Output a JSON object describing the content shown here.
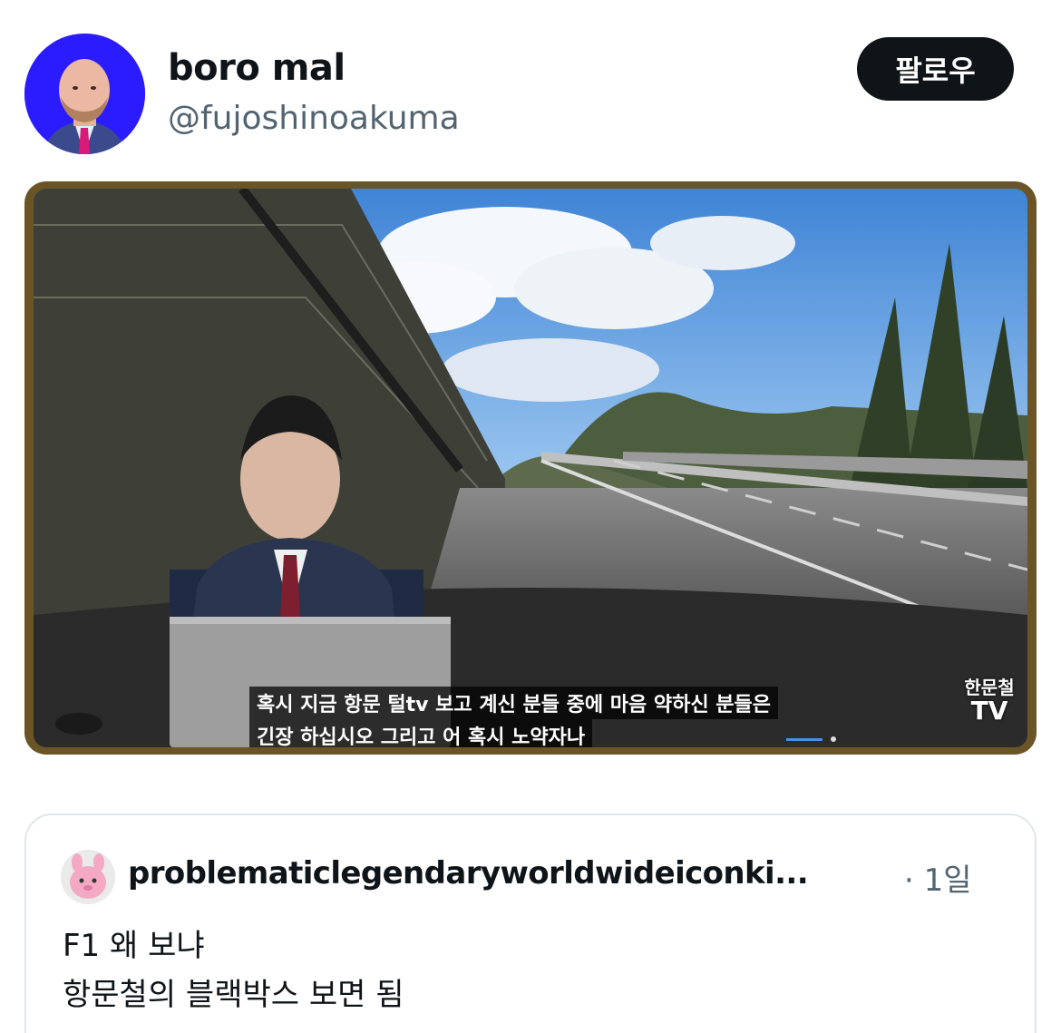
{
  "author": {
    "display_name": "boro mal",
    "handle": "@fujoshinoakuma",
    "follow_label": "팔로우",
    "avatar_bg": "#2a1cff"
  },
  "media": {
    "subtitle_line1": "혹시 지금 항문 털tv 보고 계신 분들 중에 마음 약하신 분들은",
    "subtitle_line2": "긴장 하십시오 그리고 어 혹시 노약자나",
    "logo_line1": "한문철",
    "logo_line2": "TV"
  },
  "quoted_post": {
    "display_name": "problematiclegendaryworldwideiconki...",
    "time": "· 1일",
    "text_line1": "F1 왜 보냐",
    "text_line2": "항문철의 블랙박스 보면 됨"
  }
}
